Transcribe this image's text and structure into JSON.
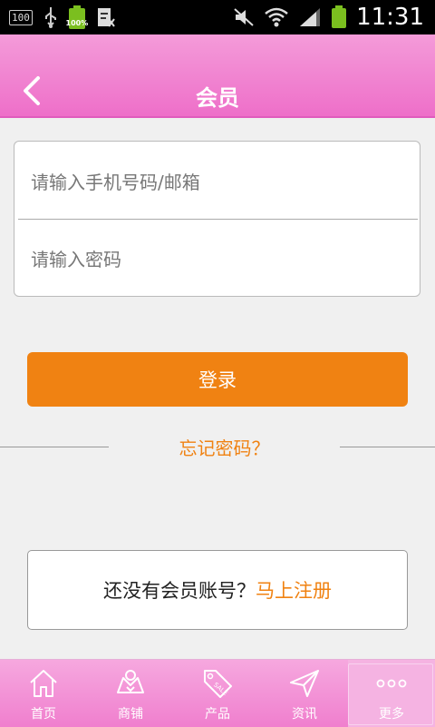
{
  "status_bar": {
    "badge": "100",
    "battery_left_text": "100%",
    "time": "11:31"
  },
  "header": {
    "title": "会员",
    "back_icon": "chevron-left-icon"
  },
  "form": {
    "phone_placeholder": "请输入手机号码/邮箱",
    "password_placeholder": "请输入密码"
  },
  "login_button": "登录",
  "forgot_password": "忘记密码？",
  "register": {
    "prompt": "还没有会员账号？",
    "link": "马上注册"
  },
  "bottom_nav": [
    {
      "label": "首页",
      "icon": "home-icon"
    },
    {
      "label": "商铺",
      "icon": "shop-icon"
    },
    {
      "label": "产品",
      "icon": "sale-tag-icon"
    },
    {
      "label": "资讯",
      "icon": "send-icon"
    },
    {
      "label": "更多",
      "icon": "more-icon"
    }
  ],
  "colors": {
    "accent": "#f08212",
    "header_pink": "#ee6fc9",
    "nav_pink": "#f07fce"
  }
}
